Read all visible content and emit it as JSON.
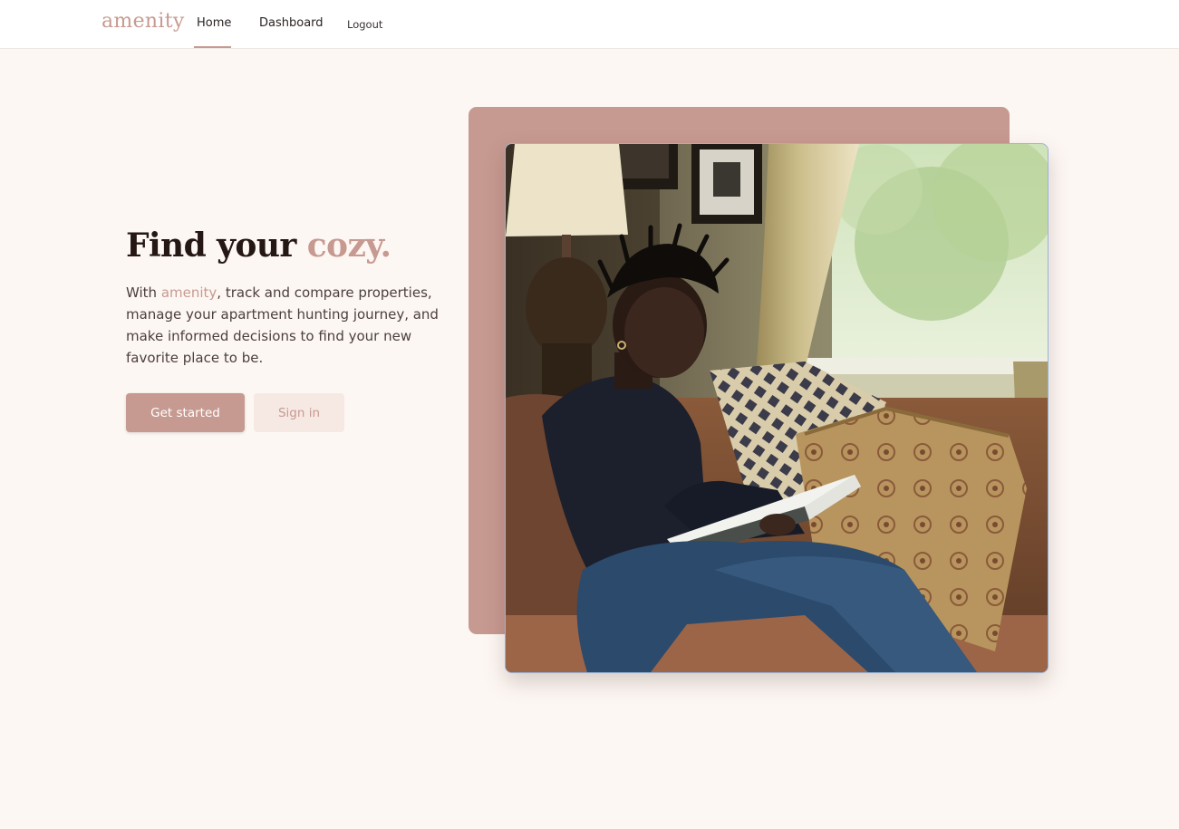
{
  "nav": {
    "brand": "amenity",
    "links": [
      {
        "label": "Home",
        "active": true
      },
      {
        "label": "Dashboard",
        "active": false
      },
      {
        "label": "Logout",
        "active": false
      }
    ]
  },
  "hero": {
    "headline_main": "Find your ",
    "headline_accent": "cozy.",
    "lede_prefix": "With ",
    "lede_brand": "amenity",
    "lede_suffix": ", track and compare properties, manage your apartment hunting journey, and make informed decisions to find your new favorite place to be.",
    "primary_button": "Get started",
    "secondary_button": "Sign in",
    "image_subject": "woman-reading-on-couch-photo"
  },
  "colors": {
    "accent": "#c79a91",
    "page_background": "#fdf7f3",
    "secondary_button_bg": "#f6e8e3",
    "heading_text": "#241714"
  }
}
